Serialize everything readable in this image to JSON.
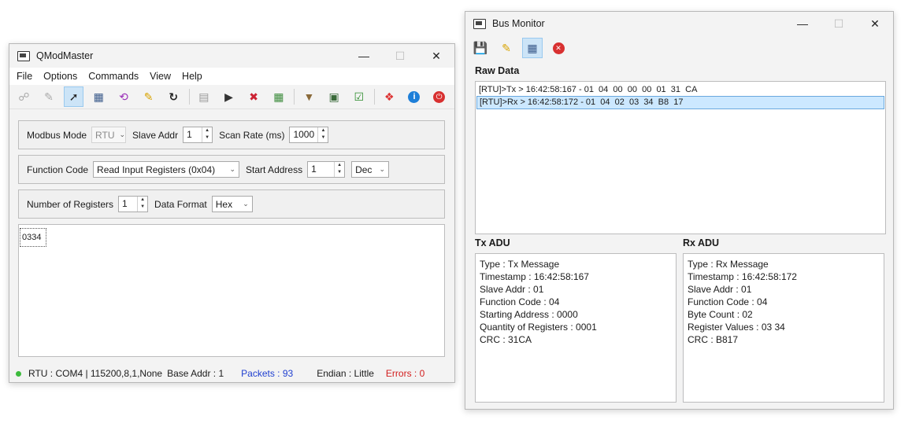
{
  "qmod": {
    "title": "QModMaster",
    "menu": [
      "File",
      "Options",
      "Commands",
      "View",
      "Help"
    ],
    "toolbar_icons": [
      "open-icon",
      "export-icon",
      "connect-icon",
      "bus-monitor-icon",
      "loop-icon",
      "clear-icon",
      "refresh-icon",
      "log-icon",
      "scan-icon",
      "tools-icon",
      "table-icon",
      "filter-icon",
      "network-icon",
      "check-icon",
      "help-ring-icon",
      "info-icon",
      "exit-icon"
    ],
    "modbus_mode_label": "Modbus Mode",
    "modbus_mode_value": "RTU",
    "slave_addr_label": "Slave Addr",
    "slave_addr_value": "1",
    "scan_rate_label": "Scan Rate (ms)",
    "scan_rate_value": "1000",
    "function_code_label": "Function Code",
    "function_code_value": "Read Input Registers (0x04)",
    "start_address_label": "Start Address",
    "start_address_value": "1",
    "start_address_format": "Dec",
    "num_registers_label": "Number of Registers",
    "num_registers_value": "1",
    "data_format_label": "Data Format",
    "data_format_value": "Hex",
    "register_value": "0334",
    "status": {
      "connection": "RTU : COM4 | 115200,8,1,None",
      "base_addr": "Base Addr : 1",
      "packets": "Packets : 93",
      "endian": "Endian : Little",
      "errors": "Errors : 0"
    }
  },
  "bus": {
    "title": "Bus Monitor",
    "raw_data_heading": "Raw Data",
    "raw_rows": [
      "[RTU]>Tx > 16:42:58:167 - 01  04  00  00  00  01  31  CA",
      "[RTU]>Rx > 16:42:58:172 - 01  04  02  03  34  B8  17"
    ],
    "tx_heading": "Tx ADU",
    "rx_heading": "Rx ADU",
    "tx_lines": [
      "Type : Tx Message",
      "Timestamp : 16:42:58:167",
      "Slave Addr : 01",
      "Function Code : 04",
      "Starting Address : 0000",
      "Quantity of Registers : 0001",
      "CRC : 31CA"
    ],
    "rx_lines": [
      "Type : Rx Message",
      "Timestamp : 16:42:58:172",
      "Slave Addr : 01",
      "Function Code : 04",
      "Byte Count : 02",
      "Register Values : 03 34",
      "CRC : B817"
    ]
  },
  "colors": {
    "packets": "#1f3fd0",
    "errors": "#d21e1e",
    "status_led": "#3dbb3d",
    "selection": "#cce8ff"
  }
}
